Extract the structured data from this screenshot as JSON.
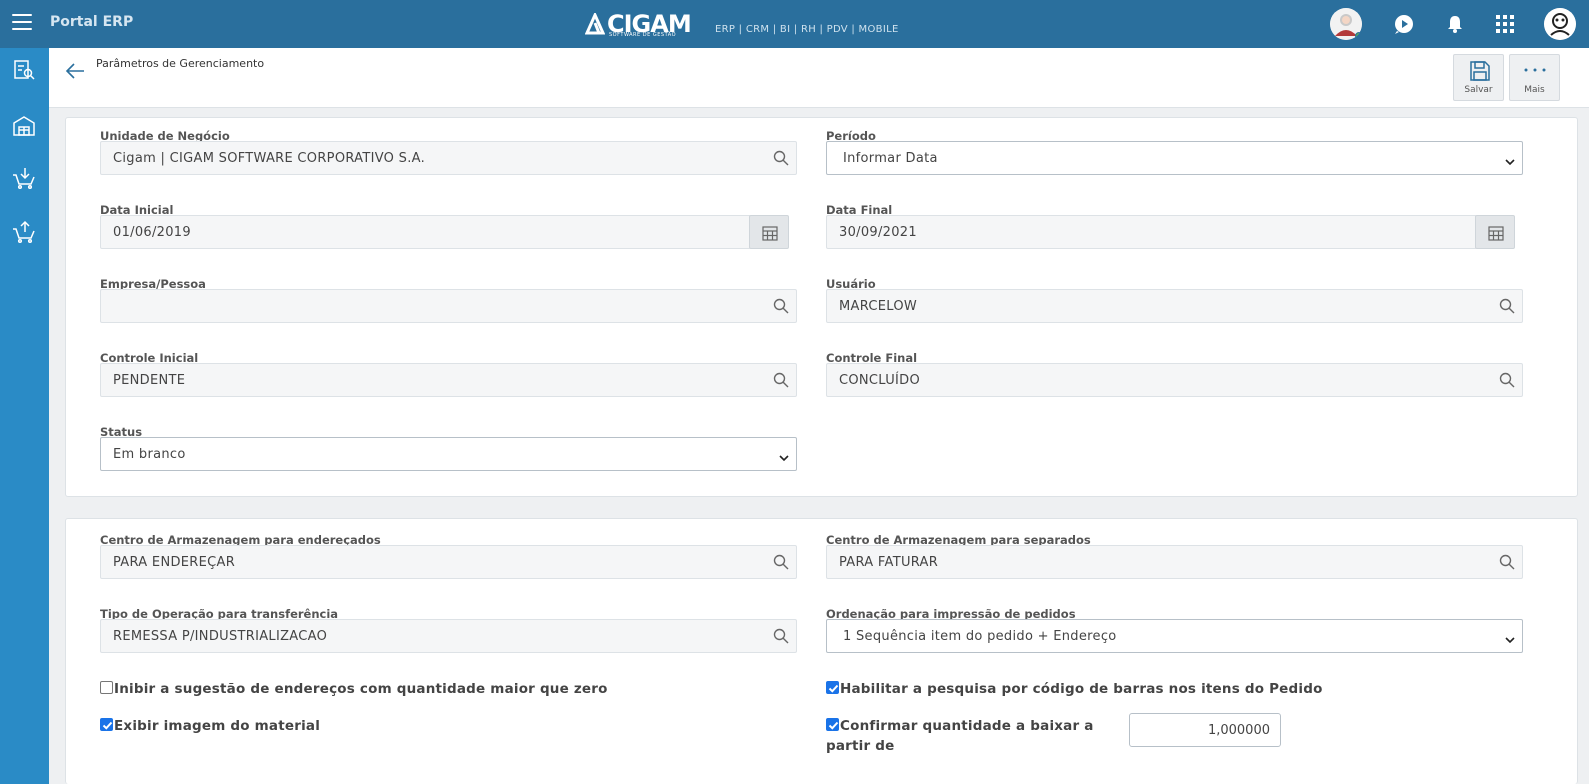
{
  "topbar": {
    "app_title": "Portal ERP",
    "logo_text": "CIGAM",
    "logo_sub": "SOFTWARE DE GESTÃO",
    "modules": "ERP | CRM | BI | RH | PDV | MOBILE"
  },
  "header": {
    "page_title": "Parâmetros de Gerenciamento",
    "save_label": "Salvar",
    "more_label": "Mais"
  },
  "form1": {
    "unidade_label": "Unidade de Negócio",
    "unidade_value": "Cigam | CIGAM SOFTWARE CORPORATIVO S.A.",
    "periodo_label": "Período",
    "periodo_value": "Informar Data",
    "data_inicial_label": "Data Inicial",
    "data_inicial_value": "01/06/2019",
    "data_final_label": "Data Final",
    "data_final_value": "30/09/2021",
    "empresa_label": "Empresa/Pessoa",
    "empresa_value": "",
    "usuario_label": "Usuário",
    "usuario_value": "MARCELOW",
    "controle_inicial_label": "Controle Inicial",
    "controle_inicial_value": "PENDENTE",
    "controle_final_label": "Controle Final",
    "controle_final_value": "CONCLUÍDO",
    "status_label": "Status",
    "status_value": "Em branco"
  },
  "form2": {
    "centro_end_label": "Centro de Armazenagem para endereçados",
    "centro_end_value": "PARA ENDEREÇAR",
    "centro_sep_label": "Centro de Armazenagem para separados",
    "centro_sep_value": "PARA FATURAR",
    "tipo_op_label": "Tipo de Operação para transferência",
    "tipo_op_value": "REMESSA P/INDUSTRIALIZACAO",
    "ordenacao_label": "Ordenação para impressão de pedidos",
    "ordenacao_value": "1 Sequência item do pedido + Endereço",
    "inibir_label": "Inibir a sugestão de endereços com quantidade maior que zero",
    "inibir_checked": false,
    "habilitar_label": "Habilitar a pesquisa por código de barras nos itens do Pedido",
    "habilitar_checked": true,
    "exibir_label": "Exibir imagem do material",
    "exibir_checked": true,
    "confirmar_label_1": "Confirmar quantidade a baixar a",
    "confirmar_label_2": "partir de",
    "confirmar_checked": true,
    "confirmar_value": "1,000000"
  },
  "colors": {
    "topbar": "#2a6f9d",
    "sidebar": "#2a8bc6",
    "background": "#eef0f2",
    "checkbox": "#1a73e8"
  },
  "icons": {
    "topbar": [
      "menu-icon",
      "avatar",
      "play-circle-icon",
      "bell-icon",
      "apps-grid-icon",
      "user-avatar"
    ],
    "sidebar": [
      "report-search-icon",
      "warehouse-icon",
      "cart-download-icon",
      "cart-upload-icon"
    ],
    "header": [
      "back-arrow-icon",
      "save-icon",
      "more-icon"
    ]
  }
}
